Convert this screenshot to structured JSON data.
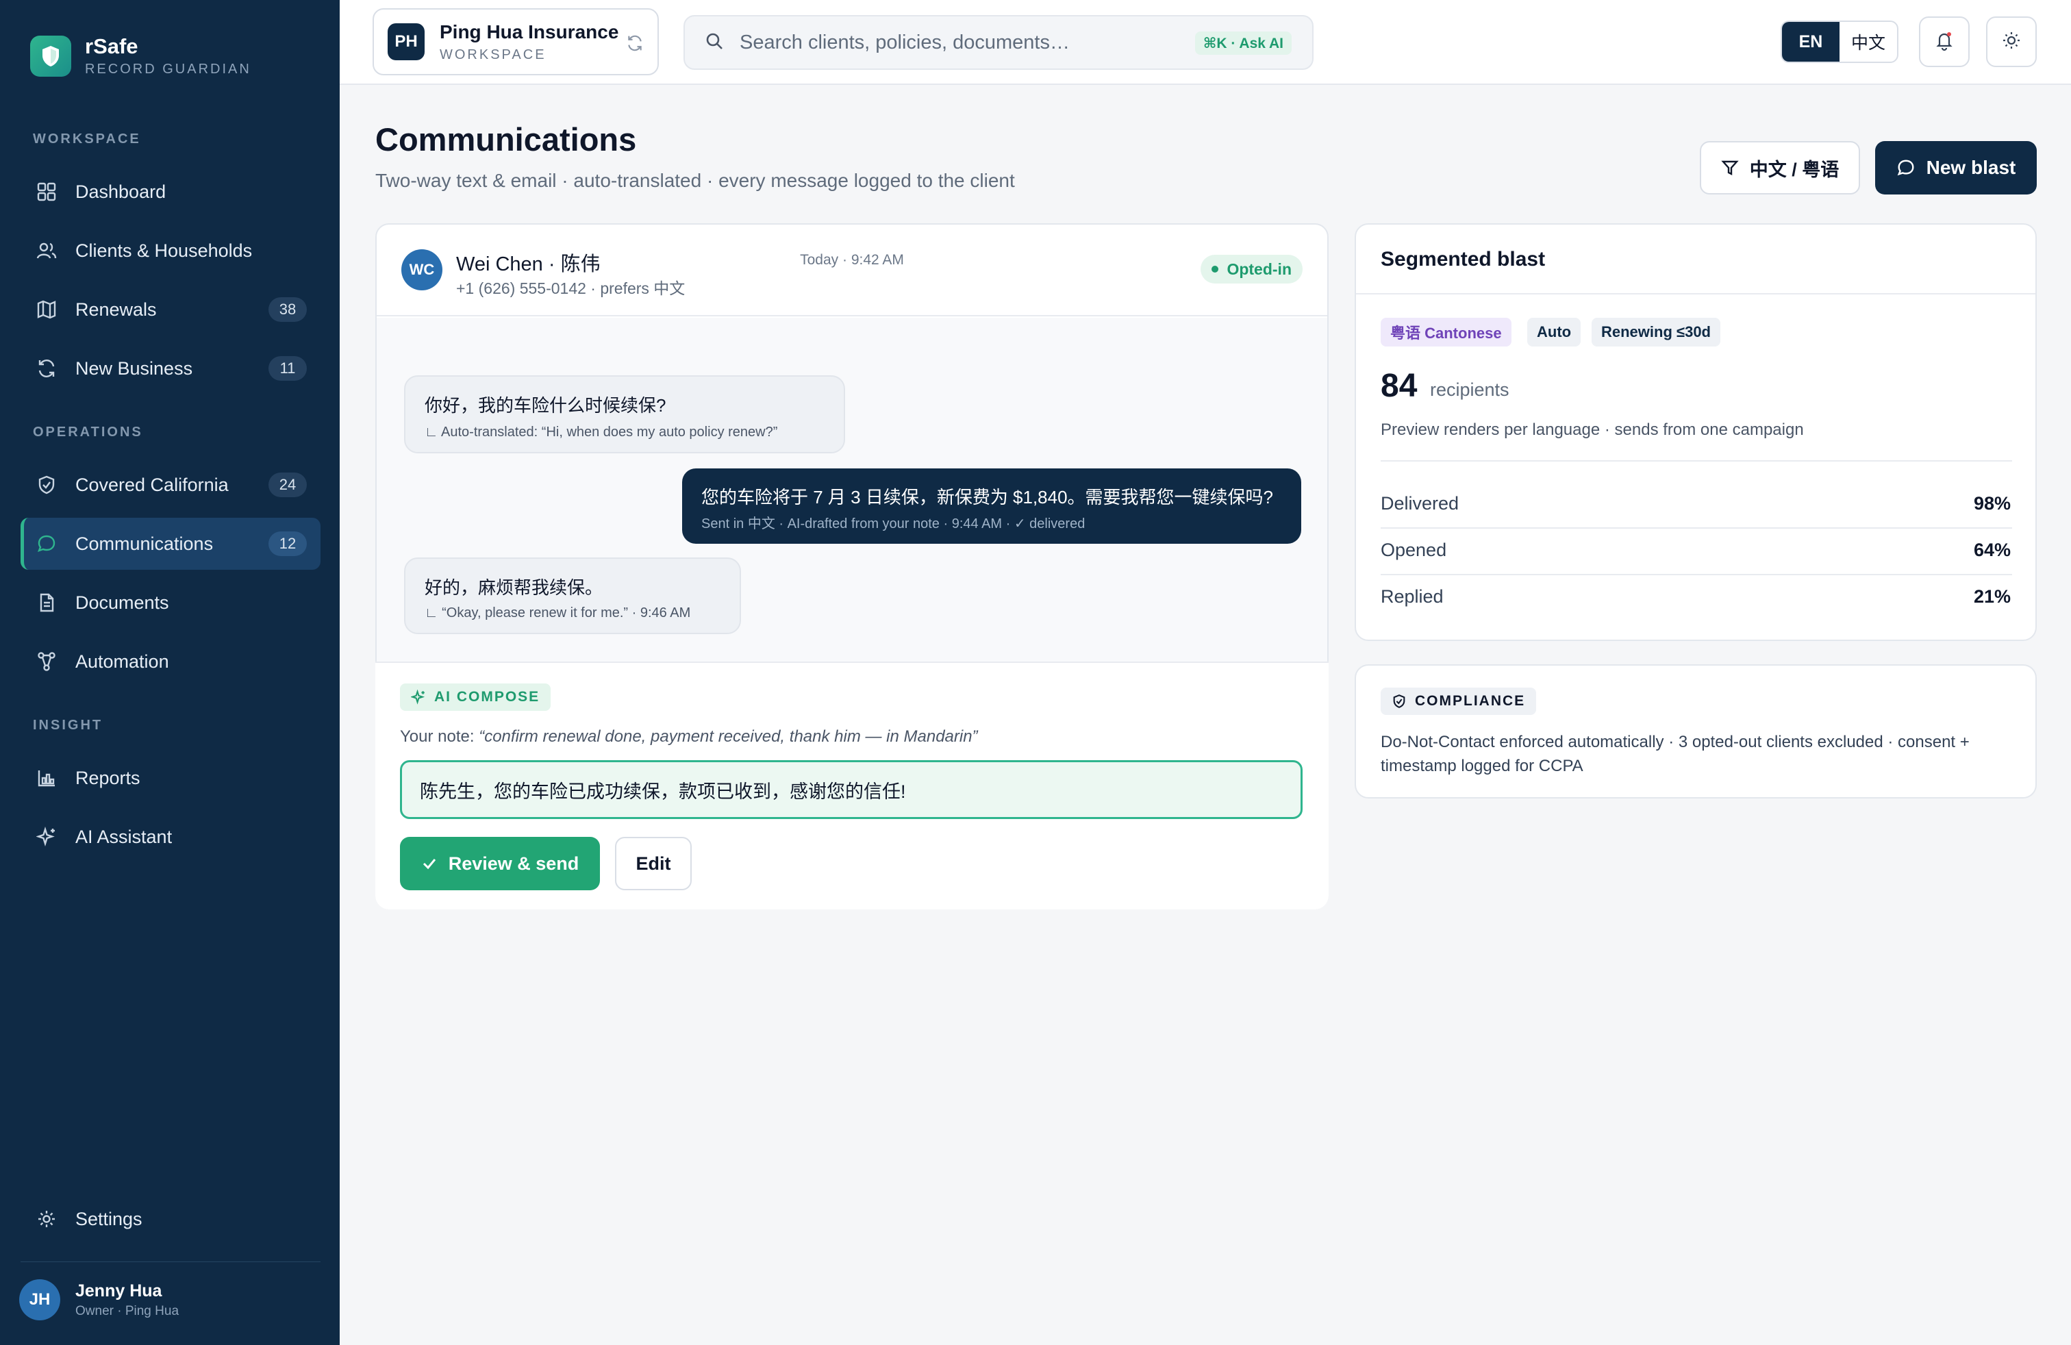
{
  "brand": {
    "name": "rSafe",
    "subtitle": "RECORD GUARDIAN"
  },
  "sidebar": {
    "sections": [
      "WORKSPACE",
      "OPERATIONS",
      "INSIGHT"
    ],
    "items": [
      {
        "label": "Dashboard",
        "icon": "grid-icon",
        "badge": null
      },
      {
        "label": "Clients & Households",
        "icon": "users-icon",
        "badge": null
      },
      {
        "label": "Renewals",
        "icon": "map-icon",
        "badge": "38"
      },
      {
        "label": "New Business",
        "icon": "refresh-icon",
        "badge": "11"
      },
      {
        "label": "Covered California",
        "icon": "shield-check-icon",
        "badge": "24"
      },
      {
        "label": "Communications",
        "icon": "chat-icon",
        "badge": "12",
        "active": true
      },
      {
        "label": "Documents",
        "icon": "document-icon",
        "badge": null
      },
      {
        "label": "Automation",
        "icon": "workflow-icon",
        "badge": null
      },
      {
        "label": "Reports",
        "icon": "bar-chart-icon",
        "badge": null
      },
      {
        "label": "AI Assistant",
        "icon": "sparkle-icon",
        "badge": null
      },
      {
        "label": "Settings",
        "icon": "gear-icon",
        "badge": null
      }
    ],
    "user": {
      "initials": "JH",
      "name": "Jenny Hua",
      "role": "Owner · Ping Hua"
    }
  },
  "topbar": {
    "workspace": {
      "initials": "PH",
      "name": "Ping Hua Insurance",
      "label": "WORKSPACE"
    },
    "search": {
      "placeholder": "Search clients, policies, documents…",
      "shortcut": "⌘K · Ask AI"
    },
    "languages": [
      "EN",
      "中文"
    ],
    "active_language": "EN"
  },
  "page": {
    "title": "Communications",
    "subtitle": "Two-way text & email · auto-translated · every message logged to the client",
    "filter_label": "中文 / 粤语",
    "new_blast_label": "New blast"
  },
  "conversation": {
    "contact": {
      "initials": "WC",
      "name": "Wei Chen · 陈伟",
      "phone_pref": "+1 (626) 555-0142 · prefers 中文",
      "status": "Opted-in"
    },
    "timestamp": "Today · 9:42 AM",
    "messages": [
      {
        "dir": "in",
        "text": "你好，我的车险什么时候续保?",
        "meta": "∟ Auto-translated: “Hi, when does my auto policy renew?”"
      },
      {
        "dir": "out",
        "text": "您的车险将于 7 月 3 日续保，新保费为 $1,840。需要我帮您一键续保吗?",
        "meta": "Sent in 中文 · AI-drafted from your note · 9:44 AM · ✓ delivered"
      },
      {
        "dir": "in",
        "text": "好的，麻烦帮我续保。",
        "meta": "∟ “Okay, please renew it for me.” · 9:46 AM"
      }
    ],
    "compose": {
      "tag": "AI COMPOSE",
      "note_prefix": "Your note: ",
      "note": "“confirm renewal done, payment received, thank him — in Mandarin”",
      "draft": "陈先生，您的车险已成功续保，款项已收到，感谢您的信任!",
      "send_label": "Review & send",
      "edit_label": "Edit"
    }
  },
  "blast": {
    "title": "Segmented blast",
    "chips": [
      "粤语 Cantonese",
      "Auto",
      "Renewing ≤30d"
    ],
    "recipients": "84",
    "recipients_label": "recipients",
    "preview": "Preview renders per language · sends from one campaign",
    "stats": [
      {
        "label": "Delivered",
        "value": "98%"
      },
      {
        "label": "Opened",
        "value": "64%"
      },
      {
        "label": "Replied",
        "value": "21%"
      }
    ]
  },
  "compliance": {
    "tag": "COMPLIANCE",
    "text": "Do-Not-Contact enforced automatically · 3 opted-out clients excluded · consent + timestamp logged for CCPA"
  },
  "colors": {
    "sidebar": "#0f2a45",
    "accent": "#2fb58e",
    "brand_dark": "#0f2a45"
  }
}
